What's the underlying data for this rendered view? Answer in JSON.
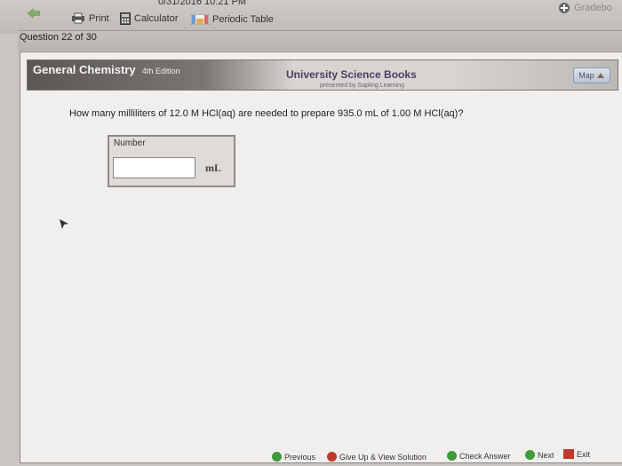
{
  "header": {
    "clock_partial": "0/31/2016 10:21 PM",
    "gradebook_partial": "Gradebo"
  },
  "toolbar": {
    "print_label": "Print",
    "calculator_label": "Calculator",
    "periodic_table_label": "Periodic Table"
  },
  "progress": {
    "label": "Question 22 of 30"
  },
  "banner": {
    "title": "General Chemistry",
    "edition": "4th Edition",
    "publisher": "University Science Books",
    "publisher_sub": "presented by Sapling Learning",
    "map_label": "Map"
  },
  "question": {
    "text": "How many milliliters of 12.0 M HCl(aq) are needed to prepare 935.0 mL of 1.00 M HCl(aq)?",
    "answer_label": "Number",
    "answer_value": "",
    "unit": "mL"
  },
  "nav": {
    "previous": "Previous",
    "give_up": "Give Up & View Solution",
    "check": "Check Answer",
    "next": "Next",
    "exit": "Exit"
  },
  "colors": {
    "green": "#3f9a3a",
    "red": "#c03a2b",
    "blue": "#2a63b8"
  }
}
